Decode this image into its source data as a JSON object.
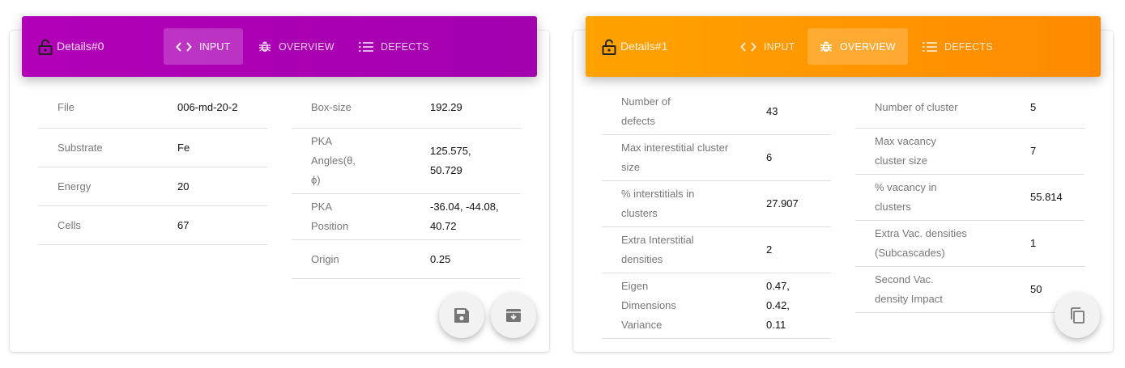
{
  "panels": [
    {
      "title": "Details#0",
      "tabs": [
        "INPUT",
        "OVERVIEW",
        "DEFECTS"
      ],
      "active_tab": "INPUT",
      "accent": [
        "#b200b8",
        "#a300ae"
      ],
      "left_table": [
        {
          "label": "File",
          "value": "006-md-20-2"
        },
        {
          "label": "Substrate",
          "value": "Fe"
        },
        {
          "label": "Energy",
          "value": "20"
        },
        {
          "label": "Cells",
          "value": "67"
        }
      ],
      "right_table": [
        {
          "label": "Box-size",
          "value": "192.29"
        },
        {
          "label": "PKA Angles(θ, ϕ)",
          "value": "125.575, 50.729"
        },
        {
          "label": "PKA Position",
          "value": "-36.04, -44.08, 40.72"
        },
        {
          "label": "Origin",
          "value": "0.25"
        }
      ],
      "actions": [
        "save-icon",
        "archive-icon"
      ]
    },
    {
      "title": "Details#1",
      "tabs": [
        "INPUT",
        "OVERVIEW",
        "DEFECTS"
      ],
      "active_tab": "OVERVIEW",
      "accent": [
        "#ffa300",
        "#ff8a00"
      ],
      "left_table": [
        {
          "label": "Number of defects",
          "value": "43"
        },
        {
          "label": "Max interestitial cluster size",
          "value": "6"
        },
        {
          "label": "% interstitials in clusters",
          "value": "27.907"
        },
        {
          "label": "Extra Interstitial densities",
          "value": "2"
        },
        {
          "label": "Eigen Dimensions Variance",
          "value": "0.47, 0.42, 0.11"
        }
      ],
      "right_table": [
        {
          "label": "Number of cluster",
          "value": "5"
        },
        {
          "label": "Max vacancy cluster size",
          "value": "7"
        },
        {
          "label": "% vacancy in clusters",
          "value": "55.814"
        },
        {
          "label": "Extra Vac. densities (Subcascades)",
          "value": "1"
        },
        {
          "label": "Second Vac. density Impact",
          "value": "50"
        }
      ],
      "actions": [
        "copy-icon"
      ]
    }
  ]
}
